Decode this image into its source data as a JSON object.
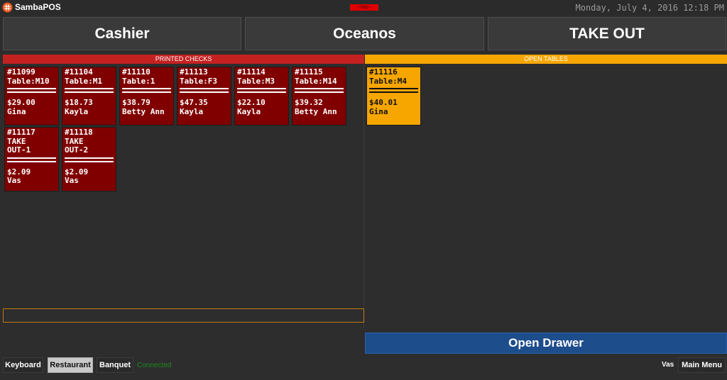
{
  "app": {
    "title": "SambaPOS",
    "user_pill": "--Vas--",
    "datetime": "Monday, July 4, 2016 12:18 PM"
  },
  "header": {
    "buttons": [
      {
        "label": "Cashier"
      },
      {
        "label": "Oceanos"
      },
      {
        "label": "TAKE OUT"
      }
    ]
  },
  "printed_checks": {
    "title": "PRINTED CHECKS",
    "tickets": [
      {
        "number": "#11099",
        "table": "Table:M10",
        "amount": "$29.00",
        "waiter": "Gina"
      },
      {
        "number": "#11104",
        "table": "Table:M1",
        "amount": "$18.73",
        "waiter": "Kayla"
      },
      {
        "number": "#11110",
        "table": "Table:1",
        "amount": "$38.79",
        "waiter": "Betty Ann"
      },
      {
        "number": "#11113",
        "table": "Table:F3",
        "amount": "$47.35",
        "waiter": "Kayla"
      },
      {
        "number": "#11114",
        "table": "Table:M3",
        "amount": "$22.10",
        "waiter": "Kayla"
      },
      {
        "number": "#11115",
        "table": "Table:M14",
        "amount": "$39.32",
        "waiter": "Betty Ann"
      },
      {
        "number": "#11117",
        "table": "TAKE\nOUT-1",
        "amount": "$2.09",
        "waiter": "Vas"
      },
      {
        "number": "#11118",
        "table": "TAKE\nOUT-2",
        "amount": "$2.09",
        "waiter": "Vas"
      }
    ]
  },
  "open_tables": {
    "title": "OPEN TABLES",
    "tickets": [
      {
        "number": "#11116",
        "table": "Table:M4",
        "amount": "$40.01",
        "waiter": "Gina"
      }
    ]
  },
  "actions": {
    "open_drawer": "Open Drawer"
  },
  "bottom": {
    "keyboard": "Keyboard",
    "restaurant": "Restaurant",
    "banquet": "Banquet",
    "status": "Connected",
    "user": "Vas",
    "main_menu": "Main Menu"
  },
  "colors": {
    "printed": "#800000",
    "open": "#f7a600",
    "drawer": "#1e4d8c"
  }
}
